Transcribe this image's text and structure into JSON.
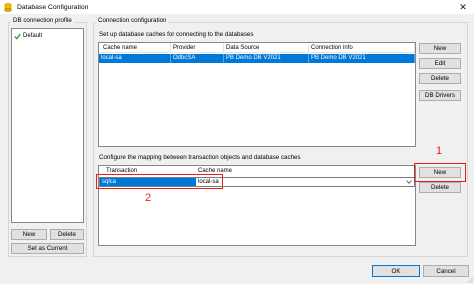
{
  "window": {
    "title": "Database Configuration",
    "close_glyph": "✕"
  },
  "profile_panel": {
    "label": "DB connection profile",
    "items": [
      {
        "label": "Default",
        "checked": true
      }
    ],
    "new_label": "New",
    "delete_label": "Delete",
    "set_current_label": "Set as Current"
  },
  "connection_panel": {
    "label": "Connection configuration",
    "description": "Set up database caches for connecting to the databases",
    "columns": [
      "Cache name",
      "Provider",
      "Data Source",
      "Connection info"
    ],
    "rows": [
      [
        "local-sa",
        "OdbcSA",
        "PB Demo DB V2021",
        "PB Demo DB V2021"
      ]
    ],
    "new_label": "New",
    "edit_label": "Edit",
    "delete_label": "Delete",
    "db_drivers_label": "DB Drivers"
  },
  "mapping_panel": {
    "description": "Configure the mapping between transaction objects and database caches",
    "columns": [
      "Transaction",
      "Cache name"
    ],
    "rows": [
      {
        "transaction": "sqlca",
        "cache_name": "local-sa"
      }
    ],
    "new_label": "New",
    "delete_label": "Delete"
  },
  "annotations": {
    "marker_1": "1",
    "marker_2": "2",
    "color": "#e0201b"
  },
  "footer": {
    "ok_label": "OK",
    "cancel_label": "Cancel"
  },
  "colors": {
    "selection": "#0078d7",
    "window_bg": "#f0f0f0"
  }
}
